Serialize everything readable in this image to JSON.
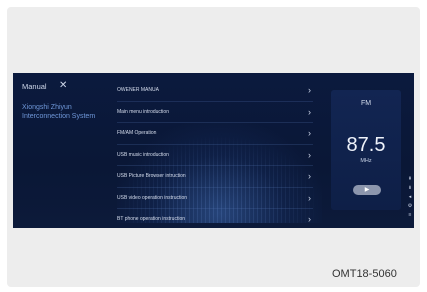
{
  "header": {
    "title": "Manual",
    "close_glyph": "✕"
  },
  "system_name": "Xiongshi Zhiyun Interconnection System",
  "menu": {
    "items": [
      {
        "label": "OWENER MANUA"
      },
      {
        "label": "Main menu introduction"
      },
      {
        "label": "FM/AM Operation"
      },
      {
        "label": "USB music introduction"
      },
      {
        "label": "USB Picture Browser intruction"
      },
      {
        "label": "USB video operation instruction"
      },
      {
        "label": "BT phone operation instruction"
      }
    ],
    "chevron_glyph": "›"
  },
  "radio": {
    "band": "FM",
    "frequency": "87.5",
    "unit": "MHz",
    "play_glyph": "▶"
  },
  "side_icons": [
    {
      "name": "tune-up-icon",
      "glyph": "⇞"
    },
    {
      "name": "tune-down-icon",
      "glyph": "⇟"
    },
    {
      "name": "volume-icon",
      "glyph": "◂"
    },
    {
      "name": "settings-icon",
      "glyph": "⚙"
    },
    {
      "name": "menu-icon",
      "glyph": "≡"
    }
  ],
  "caption": "OMT18-5060",
  "colors": {
    "screen_background": "#0b1a3e",
    "accent_text": "#6f97d8",
    "panel_background": "#122552"
  }
}
